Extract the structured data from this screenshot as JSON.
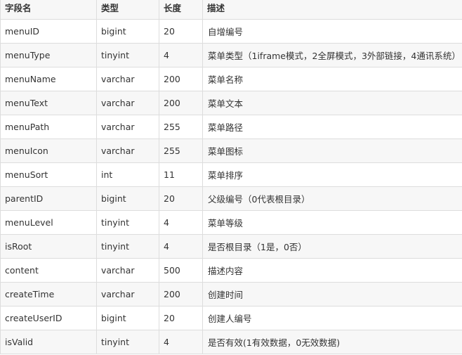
{
  "table": {
    "headers": [
      "字段名",
      "类型",
      "长度",
      "描述"
    ],
    "rows": [
      [
        "menuID",
        "bigint",
        "20",
        "自增编号"
      ],
      [
        "menuType",
        "tinyint",
        "4",
        "菜单类型（1iframe模式，2全屏模式，3外部链接，4通讯系统）"
      ],
      [
        "menuName",
        "varchar",
        "200",
        "菜单名称"
      ],
      [
        "menuText",
        "varchar",
        "200",
        "菜单文本"
      ],
      [
        "menuPath",
        "varchar",
        "255",
        "菜单路径"
      ],
      [
        "menuIcon",
        "varchar",
        "255",
        "菜单图标"
      ],
      [
        "menuSort",
        "int",
        "11",
        "菜单排序"
      ],
      [
        "parentID",
        "bigint",
        "20",
        "父级编号（0代表根目录）"
      ],
      [
        "menuLevel",
        "tinyint",
        "4",
        "菜单等级"
      ],
      [
        "isRoot",
        "tinyint",
        "4",
        "是否根目录（1是，0否）"
      ],
      [
        "content",
        "varchar",
        "500",
        "描述内容"
      ],
      [
        "createTime",
        "varchar",
        "200",
        "创建时间"
      ],
      [
        "createUserID",
        "bigint",
        "20",
        "创建人编号"
      ],
      [
        "isValid",
        "tinyint",
        "4",
        "是否有效(1有效数据，0无效数据)"
      ]
    ]
  }
}
